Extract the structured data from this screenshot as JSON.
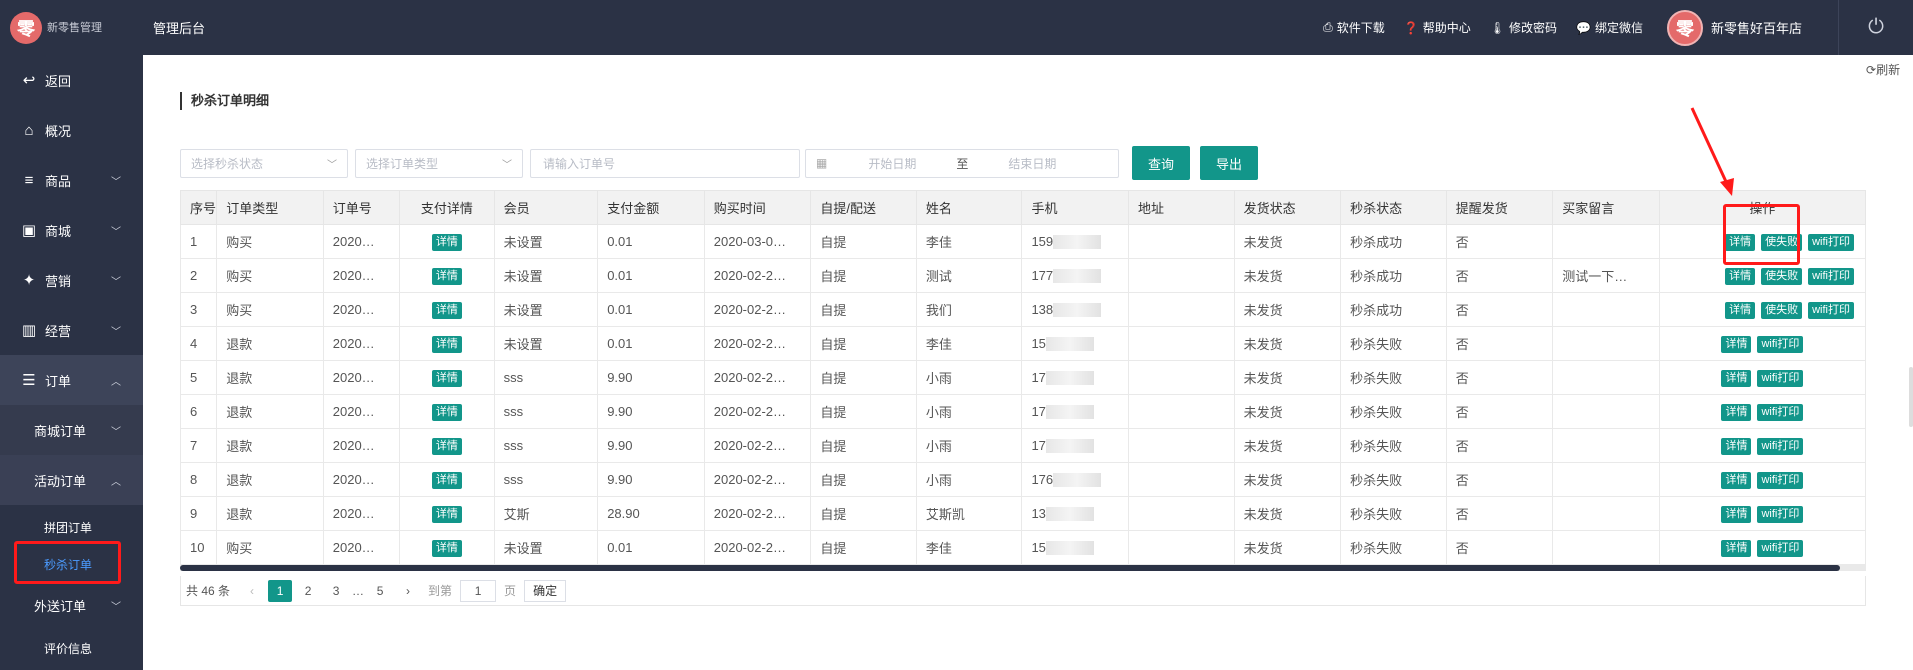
{
  "app": {
    "logo_char": "零",
    "logo_text": "新零售管理",
    "top_title": "管理后台"
  },
  "top_links": [
    {
      "icon": "printer-icon",
      "glyph": "⎙",
      "label": "软件下载"
    },
    {
      "icon": "help-icon",
      "glyph": "❓",
      "label": "帮助中心"
    },
    {
      "icon": "thermometer-icon",
      "glyph": "🌡",
      "label": "修改密码"
    },
    {
      "icon": "wechat-icon",
      "glyph": "💬",
      "label": "绑定微信"
    }
  ],
  "user": {
    "avatar_char": "零",
    "name": "新零售好百年店"
  },
  "refresh_label": "刷新",
  "sidebar": {
    "back": "返回",
    "overview": "概况",
    "goods": "商品",
    "mall": "商城",
    "marketing": "营销",
    "business": "经营",
    "orders": "订单",
    "mall_orders": "商城订单",
    "activity_orders": "活动订单",
    "group_orders": "拼团订单",
    "seckill_orders": "秒杀订单",
    "delivery_orders": "外送订单",
    "reviews": "评价信息"
  },
  "page_title": "秒杀订单明细",
  "filters": {
    "seckill_status_placeholder": "选择秒杀状态",
    "order_type_placeholder": "选择订单类型",
    "order_no_placeholder": "请输入订单号",
    "start_date": "开始日期",
    "date_sep": "至",
    "end_date": "结束日期",
    "query_label": "查询",
    "export_label": "导出"
  },
  "table": {
    "headers": [
      "序号",
      "订单类型",
      "订单号",
      "支付详情",
      "会员",
      "支付金额",
      "购买时间",
      "自提/配送",
      "姓名",
      "手机",
      "地址",
      "发货状态",
      "秒杀状态",
      "提醒发货",
      "买家留言",
      "操作"
    ],
    "detail_label": "详情",
    "fail_label": "使失败",
    "print_label": "wifi打印",
    "rows": [
      {
        "no": "1",
        "type": "购买",
        "order": "2020…",
        "member": "未设置",
        "amount": "0.01",
        "time": "2020-03-0…",
        "pickup": "自提",
        "name": "李佳",
        "phone": "159",
        "ship": "未发货",
        "status": "秒杀成功",
        "remind": "否",
        "msg": "",
        "can_fail": true
      },
      {
        "no": "2",
        "type": "购买",
        "order": "2020…",
        "member": "未设置",
        "amount": "0.01",
        "time": "2020-02-2…",
        "pickup": "自提",
        "name": "测试",
        "phone": "177",
        "ship": "未发货",
        "status": "秒杀成功",
        "remind": "否",
        "msg": "测试一下…",
        "can_fail": true
      },
      {
        "no": "3",
        "type": "购买",
        "order": "2020…",
        "member": "未设置",
        "amount": "0.01",
        "time": "2020-02-2…",
        "pickup": "自提",
        "name": "我们",
        "phone": "138",
        "ship": "未发货",
        "status": "秒杀成功",
        "remind": "否",
        "msg": "",
        "can_fail": true
      },
      {
        "no": "4",
        "type": "退款",
        "order": "2020…",
        "member": "未设置",
        "amount": "0.01",
        "time": "2020-02-2…",
        "pickup": "自提",
        "name": "李佳",
        "phone": "15",
        "ship": "未发货",
        "status": "秒杀失败",
        "remind": "否",
        "msg": "",
        "can_fail": false
      },
      {
        "no": "5",
        "type": "退款",
        "order": "2020…",
        "member": "sss",
        "amount": "9.90",
        "time": "2020-02-2…",
        "pickup": "自提",
        "name": "小雨",
        "phone": "17",
        "ship": "未发货",
        "status": "秒杀失败",
        "remind": "否",
        "msg": "",
        "can_fail": false
      },
      {
        "no": "6",
        "type": "退款",
        "order": "2020…",
        "member": "sss",
        "amount": "9.90",
        "time": "2020-02-2…",
        "pickup": "自提",
        "name": "小雨",
        "phone": "17",
        "ship": "未发货",
        "status": "秒杀失败",
        "remind": "否",
        "msg": "",
        "can_fail": false
      },
      {
        "no": "7",
        "type": "退款",
        "order": "2020…",
        "member": "sss",
        "amount": "9.90",
        "time": "2020-02-2…",
        "pickup": "自提",
        "name": "小雨",
        "phone": "17",
        "ship": "未发货",
        "status": "秒杀失败",
        "remind": "否",
        "msg": "",
        "can_fail": false
      },
      {
        "no": "8",
        "type": "退款",
        "order": "2020…",
        "member": "sss",
        "amount": "9.90",
        "time": "2020-02-2…",
        "pickup": "自提",
        "name": "小雨",
        "phone": "176",
        "ship": "未发货",
        "status": "秒杀失败",
        "remind": "否",
        "msg": "",
        "can_fail": false
      },
      {
        "no": "9",
        "type": "退款",
        "order": "2020…",
        "member": "艾斯",
        "amount": "28.90",
        "time": "2020-02-2…",
        "pickup": "自提",
        "name": "艾斯凯",
        "phone": "13",
        "ship": "未发货",
        "status": "秒杀失败",
        "remind": "否",
        "msg": "",
        "can_fail": false
      },
      {
        "no": "10",
        "type": "购买",
        "order": "2020…",
        "member": "未设置",
        "amount": "0.01",
        "time": "2020-02-2…",
        "pickup": "自提",
        "name": "李佳",
        "phone": "15",
        "ship": "未发货",
        "status": "秒杀失败",
        "remind": "否",
        "msg": "",
        "can_fail": false
      }
    ]
  },
  "pager": {
    "total": "共 46 条",
    "pages": [
      "1",
      "2",
      "3",
      "…",
      "5"
    ],
    "current": "1",
    "goto_label": "到第",
    "goto_value": "1",
    "page_unit": "页",
    "confirm_label": "确定"
  },
  "colors": {
    "sidebar": "#2b3245",
    "accent": "#12968a",
    "highlight": "#ff1a1a"
  }
}
